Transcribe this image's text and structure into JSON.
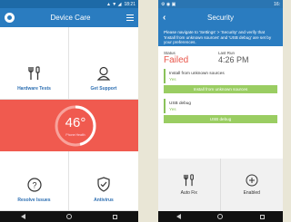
{
  "left": {
    "status_time": "18:21",
    "title": "Device Care",
    "tiles": {
      "hardware_tests": "Hardware Tests",
      "get_support": "Get Support",
      "resolve_issues": "Resolve Issues",
      "antivirus": "Antivirus"
    },
    "gauge": {
      "value": "46°",
      "sub": "Phone Health",
      "level": 0.46
    }
  },
  "right": {
    "status_time": "16:",
    "title": "Security",
    "instruction": "Please navigate to 'Settings' > 'Security' and verify that 'Install from unknown sources' and 'USB debug' are set by your preferences.",
    "status_label": "Status",
    "status_value": "Failed",
    "last_run_label": "Last Run",
    "last_run_value": "4:26 PM",
    "settings": [
      {
        "label": "Install from unknown sources",
        "value": "Yes",
        "button": "Install from unknown sources"
      },
      {
        "label": "USB debug",
        "value": "Yes",
        "button": "USB debug"
      }
    ],
    "auto_fix": "Auto Fix",
    "enabled": "Enabled"
  },
  "colors": {
    "brand": "#2a7cc0",
    "danger": "#f05a4f",
    "success": "#9acd62",
    "background": "#e9e6d6"
  }
}
